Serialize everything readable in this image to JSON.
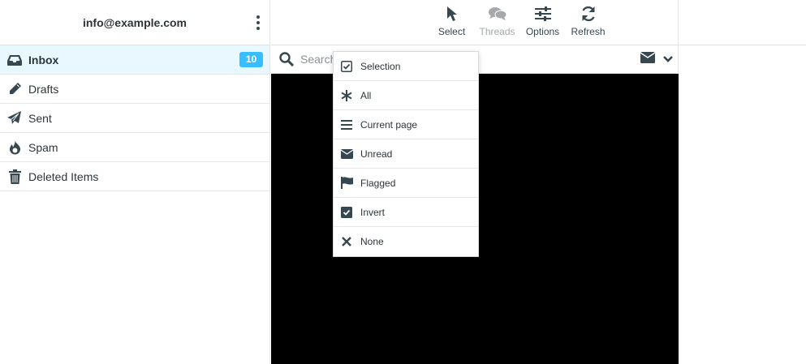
{
  "account": {
    "email": "info@example.com"
  },
  "folders": [
    {
      "label": "Inbox",
      "icon": "inbox-icon",
      "unread": "10"
    },
    {
      "label": "Drafts",
      "icon": "pencil-icon"
    },
    {
      "label": "Sent",
      "icon": "paper-plane-icon"
    },
    {
      "label": "Spam",
      "icon": "fire-icon"
    },
    {
      "label": "Deleted Items",
      "icon": "trash-icon"
    }
  ],
  "toolbar": {
    "select_label": "Select",
    "threads_label": "Threads",
    "options_label": "Options",
    "refresh_label": "Refresh"
  },
  "search": {
    "placeholder": "Search"
  },
  "select_menu": [
    {
      "label": "Selection",
      "icon": "checkbox-icon"
    },
    {
      "label": "All",
      "icon": "asterisk-icon"
    },
    {
      "label": "Current page",
      "icon": "list-icon"
    },
    {
      "label": "Unread",
      "icon": "envelope-icon"
    },
    {
      "label": "Flagged",
      "icon": "flag-icon"
    },
    {
      "label": "Invert",
      "icon": "checkbox-icon"
    },
    {
      "label": "None",
      "icon": "close-icon"
    }
  ],
  "colors": {
    "accent": "#37beff",
    "selected_bg": "#e9f7fe",
    "text": "#2c363a"
  }
}
